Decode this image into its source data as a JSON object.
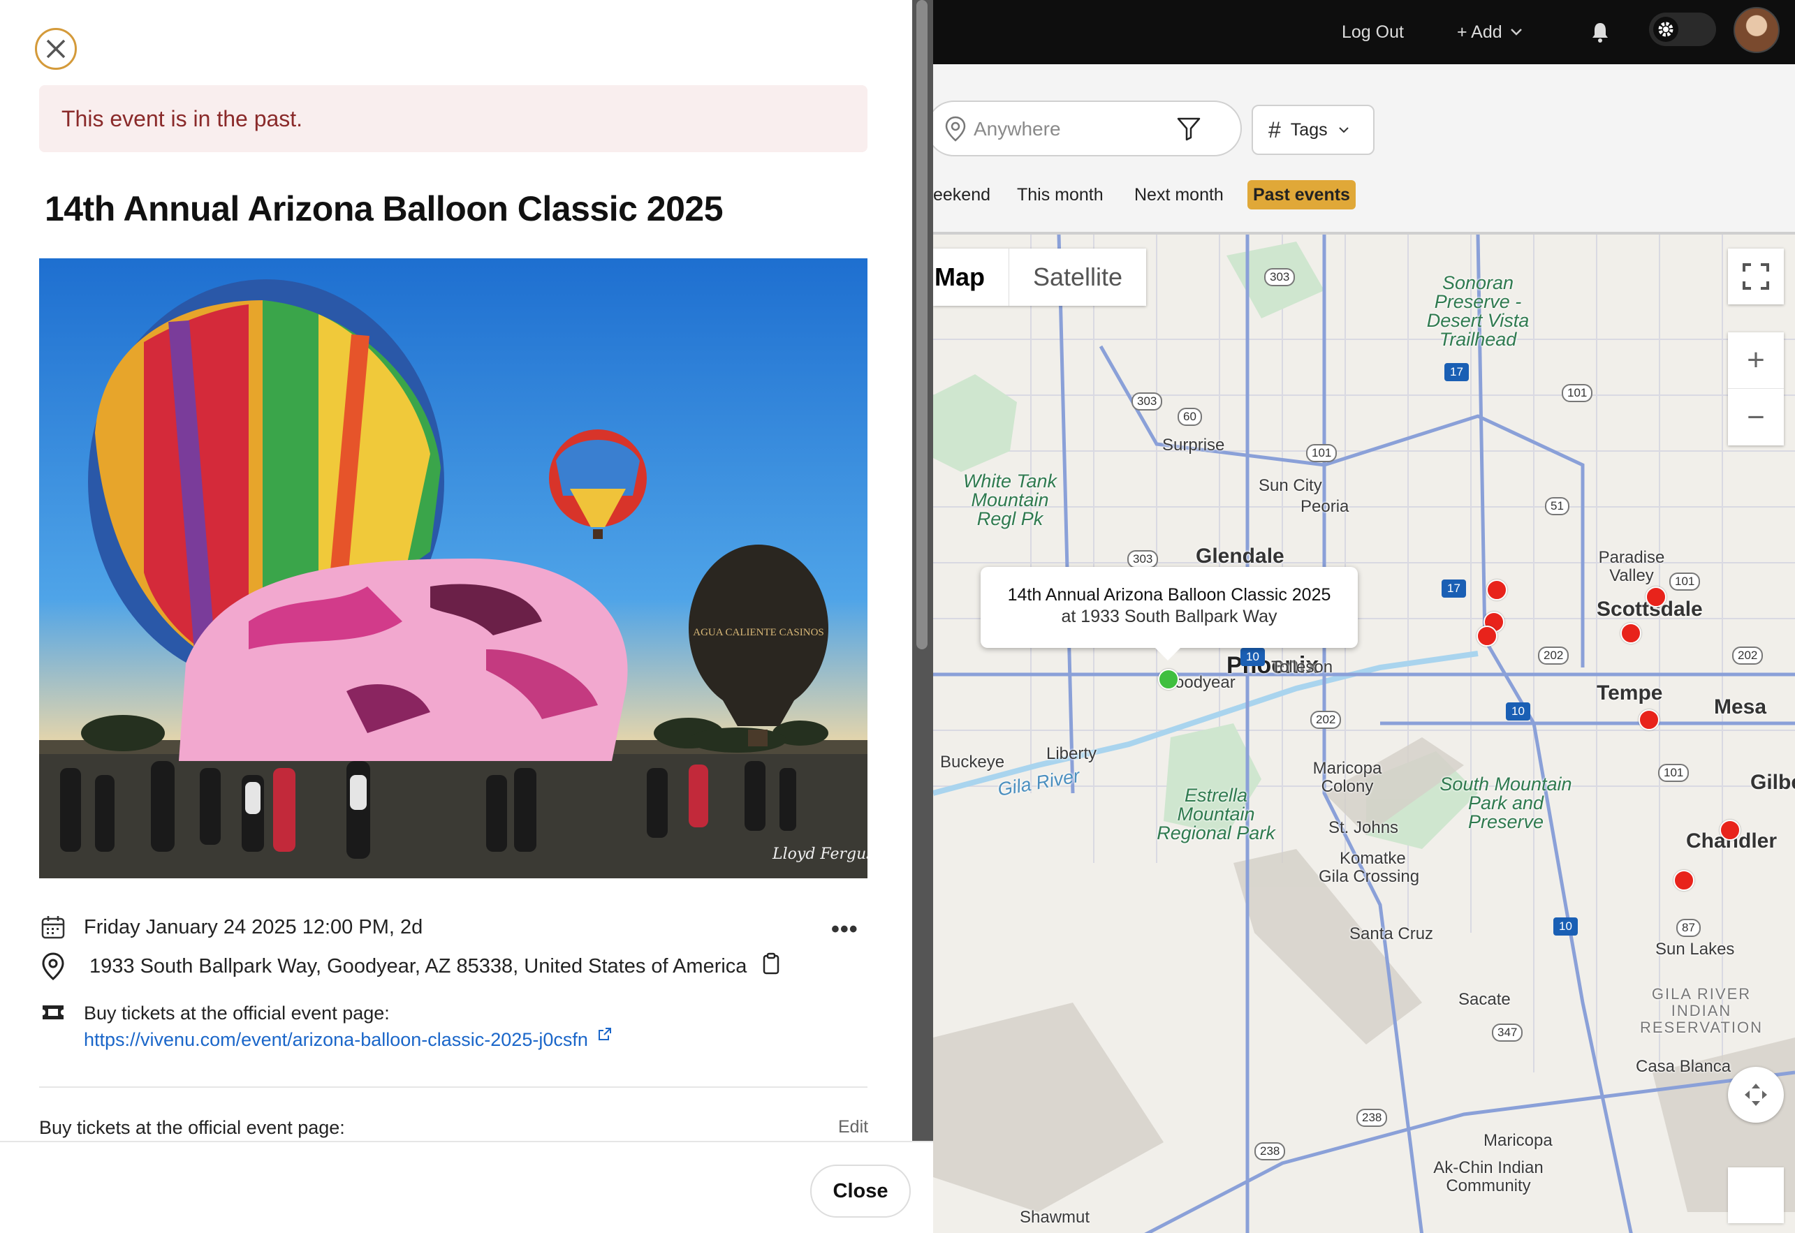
{
  "topbar": {
    "logout_label": "Log Out",
    "add_label": "+ Add",
    "icons": [
      "bell-icon",
      "gear-icon",
      "chevron-down-icon"
    ]
  },
  "filters": {
    "search_placeholder": "Anywhere",
    "tags_label": "Tags",
    "date_chips": [
      {
        "label": "eekend",
        "selected": false
      },
      {
        "label": "This month",
        "selected": false
      },
      {
        "label": "Next month",
        "selected": false
      },
      {
        "label": "Past events",
        "selected": true
      }
    ],
    "selected_color": "#e0a838"
  },
  "map": {
    "map_label": "Map",
    "satellite_label": "Satellite",
    "popup": {
      "title": "14th Annual Arizona Balloon Classic 2025",
      "subtitle": "at 1933 South Ballpark Way"
    },
    "place_labels": {
      "phoenix": "Phoenix",
      "glendale": "Glendale",
      "scottsdale": "Scottsdale",
      "tempe": "Tempe",
      "mesa": "Mesa",
      "chandler": "Chandler",
      "surprise": "Surprise",
      "sun_city": "Sun City",
      "peoria": "Peoria",
      "goodyear": "oodyear",
      "tolleson": "Tolleson",
      "buckeye": "Buckeye",
      "liberty": "Liberty",
      "maricopa_colony": "Maricopa Colony",
      "st_johns": "St. Johns",
      "komatke": "Komatke",
      "gila_crossing": "Gila Crossing",
      "santa_cruz": "Santa Cruz",
      "sacate": "Sacate",
      "sun_lakes": "Sun Lakes",
      "casa_blanca": "Casa Blanca",
      "maricopa": "Maricopa",
      "ak_chin": "Ak-Chin Indian Community",
      "shawmut": "Shawmut",
      "paradise_valley": "Paradise Valley",
      "gilbert": "Gilbe",
      "gila_river": "Gila River",
      "sonoran_preserve": "Sonoran Preserve -Desert Vista Trailhead",
      "white_tank": "White Tank Mountain Regl Pk",
      "estrella": "Estrella Mountain Regional Park",
      "south_mountain": "South Mountain Park and Preserve",
      "gila_res": "GILA RIVER INDIAN RESERVATION"
    },
    "shields": [
      "303",
      "303",
      "303",
      "60",
      "101",
      "101",
      "101",
      "101",
      "51",
      "17",
      "17",
      "10",
      "10",
      "10",
      "202",
      "202",
      "202",
      "87",
      "347",
      "238",
      "238"
    ],
    "marker_colors": {
      "past": "#e8231b",
      "selected": "#3fbf3f"
    }
  },
  "event": {
    "past_notice": "This event is in the past.",
    "title": "14th Annual Arizona Balloon Classic 2025",
    "photo_signature": "Lloyd Ferguson",
    "balloon_text": "AGUA CALIENTE CASINOS",
    "datetime": "Friday January 24 2025 12:00 PM, 2d",
    "address": "1933 South Ballpark Way, Goodyear, AZ 85338, United States of America",
    "ticket_text": "Buy tickets at the official event page:",
    "ticket_url": "https://vivenu.com/event/arizona-balloon-classic-2025-j0csfn",
    "description_label": "Buy tickets at the official event page:",
    "edit_label": "Edit",
    "close_label": "Close"
  }
}
